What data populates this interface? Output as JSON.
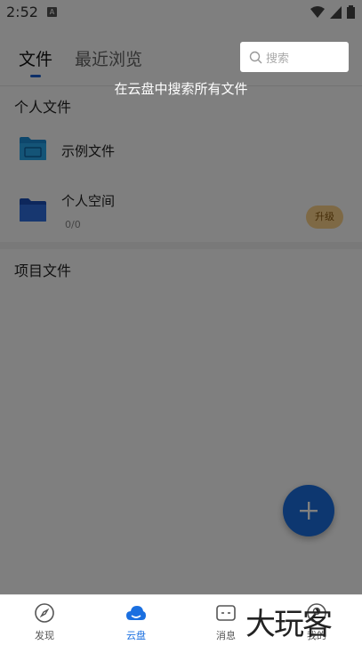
{
  "status_bar": {
    "time": "2:52",
    "app_badge": "A"
  },
  "header": {
    "tabs": [
      {
        "label": "文件",
        "active": true
      },
      {
        "label": "最近浏览",
        "active": false
      }
    ],
    "search": {
      "placeholder": "搜索"
    }
  },
  "tooltip": {
    "text": "在云盘中搜索所有文件"
  },
  "personal_section": {
    "title": "个人文件",
    "items": [
      {
        "title": "示例文件",
        "icon": "folder-sample-icon"
      },
      {
        "title": "个人空间",
        "subtitle": "0/0",
        "action_label": "升级",
        "icon": "folder-icon"
      }
    ]
  },
  "project_section": {
    "title": "项目文件"
  },
  "fab": {
    "icon": "plus-icon"
  },
  "bottom_nav": [
    {
      "label": "发现",
      "icon": "compass-icon",
      "active": false
    },
    {
      "label": "云盘",
      "icon": "cloud-icon",
      "active": true
    },
    {
      "label": "消息",
      "icon": "message-icon",
      "active": false
    },
    {
      "label": "我的",
      "icon": "profile-icon",
      "active": false
    }
  ],
  "watermark": {
    "text": "大玩客"
  },
  "colors": {
    "accent": "#1a6fe0",
    "upgrade_bg": "#fdd28a",
    "overlay": "rgba(0,0,0,0.5)"
  }
}
